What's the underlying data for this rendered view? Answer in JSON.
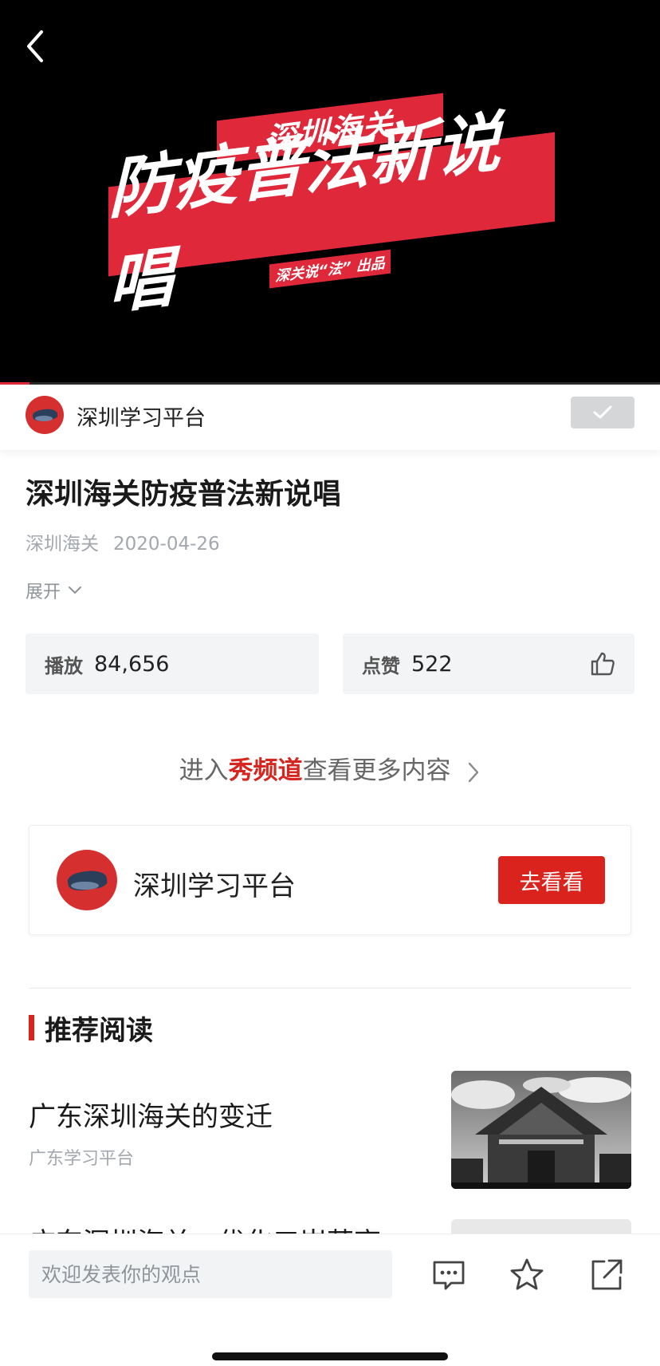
{
  "video": {
    "banner_top": "深圳海关",
    "banner_main": "防疫普法新说唱",
    "banner_sub": "深关说“法” 出品",
    "progress_fraction": 0.045
  },
  "channel": {
    "name": "深圳学习平台"
  },
  "article": {
    "title": "深圳海关防疫普法新说唱",
    "source": "深圳海关",
    "date": "2020-04-26",
    "expand_label": "展开"
  },
  "stats": {
    "play_label": "播放",
    "play_value": "84,656",
    "like_label": "点赞",
    "like_value": "522"
  },
  "enter_channel": {
    "prefix": "进入",
    "highlight": "秀频道",
    "suffix": "查看更多内容"
  },
  "channel_card": {
    "name": "深圳学习平台",
    "button": "去看看"
  },
  "recommended": {
    "heading": "推荐阅读",
    "items": [
      {
        "title": "广东深圳海关的变迁",
        "source": "广东学习平台"
      },
      {
        "title": "广东深圳海关：优化口岸营商"
      }
    ]
  },
  "bottom_bar": {
    "comment_placeholder": "欢迎发表你的观点"
  },
  "icons": {
    "back": "back-chevron-icon",
    "follow": "check-icon",
    "like": "thumbs-up-icon",
    "comment": "comment-icon",
    "favorite": "star-icon",
    "share": "share-icon"
  },
  "colors": {
    "accent": "#d9231c",
    "banner_red": "#e0283b",
    "video_bg": "#000000"
  }
}
